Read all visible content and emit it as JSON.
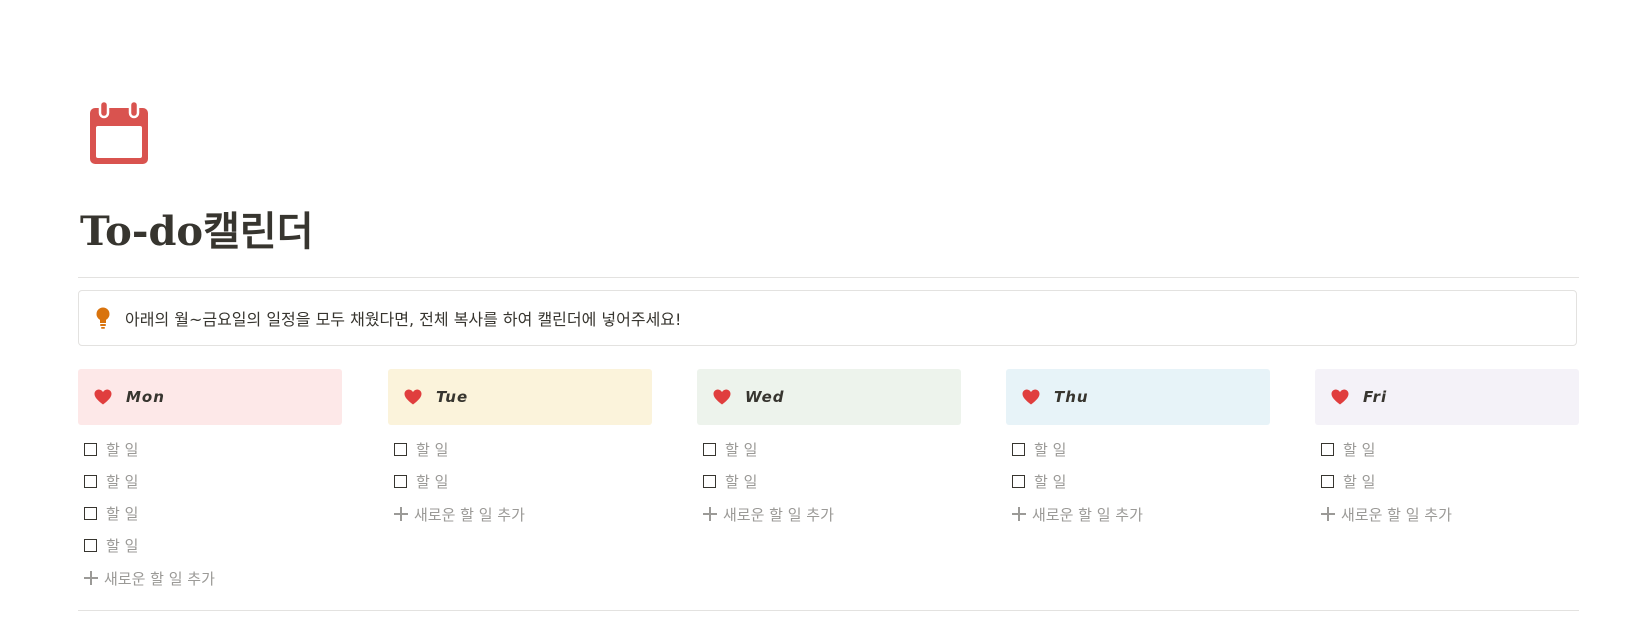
{
  "page": {
    "icon": "calendar-icon",
    "title": "To-do캘린더",
    "accent_color": "#d9534f"
  },
  "callout": {
    "icon": "lightbulb-icon",
    "icon_color": "#d9730d",
    "text": "아래의 월~금요일의 일정을 모두 채웠다면, 전체 복사를 하여 캘린더에 넣어주세요!"
  },
  "days": [
    {
      "name": "Mon",
      "icon": "heart-icon",
      "bg_color": "#fde8e8",
      "todos": [
        "할 일",
        "할 일",
        "할 일",
        "할 일"
      ],
      "add_label": "새로운 할 일 추가"
    },
    {
      "name": "Tue",
      "icon": "heart-icon",
      "bg_color": "#fbf3db",
      "todos": [
        "할 일",
        "할 일"
      ],
      "add_label": "새로운 할 일 추가"
    },
    {
      "name": "Wed",
      "icon": "heart-icon",
      "bg_color": "#edf3ec",
      "todos": [
        "할 일",
        "할 일"
      ],
      "add_label": "새로운 할 일 추가"
    },
    {
      "name": "Thu",
      "icon": "heart-icon",
      "bg_color": "#e7f3f8",
      "todos": [
        "할 일",
        "할 일"
      ],
      "add_label": "새로운 할 일 추가"
    },
    {
      "name": "Fri",
      "icon": "heart-icon",
      "bg_color": "#f4f2f8",
      "todos": [
        "할 일",
        "할 일"
      ],
      "add_label": "새로운 할 일 추가"
    }
  ],
  "heart_color": "#e03e3e"
}
